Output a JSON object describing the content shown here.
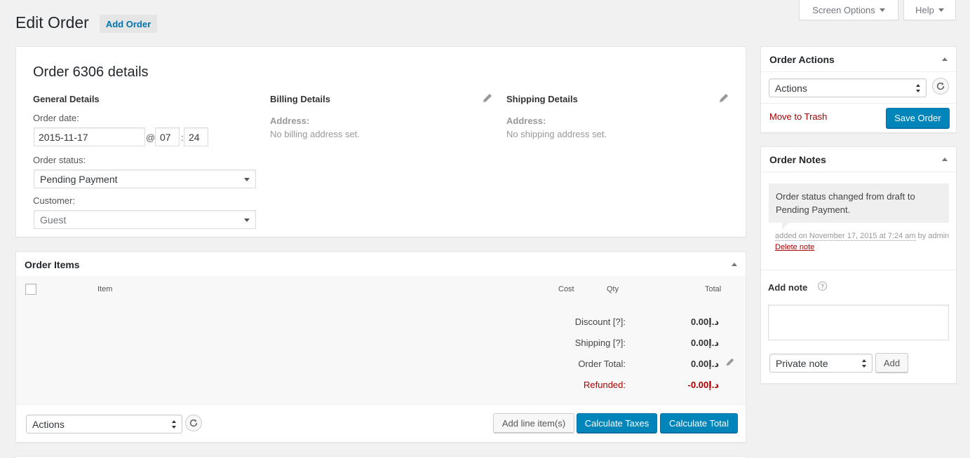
{
  "header": {
    "title": "Edit Order",
    "add_button": "Add Order",
    "screen_options": "Screen Options",
    "help": "Help"
  },
  "order_details": {
    "title": "Order 6306 details",
    "general": {
      "heading": "General Details",
      "date_label": "Order date:",
      "date_value": "2015-11-17",
      "at_symbol": "@",
      "hour": "07",
      "colon": ":",
      "minute": "24",
      "status_label": "Order status:",
      "status_value": "Pending Payment",
      "customer_label": "Customer:",
      "customer_value": "Guest"
    },
    "billing": {
      "heading": "Billing Details",
      "address_label": "Address:",
      "address_value": "No billing address set."
    },
    "shipping": {
      "heading": "Shipping Details",
      "address_label": "Address:",
      "address_value": "No shipping address set."
    }
  },
  "order_items": {
    "title": "Order Items",
    "columns": {
      "item": "Item",
      "cost": "Cost",
      "qty": "Qty",
      "total": "Total"
    },
    "totals": [
      {
        "label": "Discount [?]:",
        "value": "0.00د.إ"
      },
      {
        "label": "Shipping [?]:",
        "value": "0.00د.إ"
      },
      {
        "label": "Order Total:",
        "value": "0.00د.إ"
      },
      {
        "label": "Refunded:",
        "value": "-0.00د.إ"
      }
    ],
    "actions_select": "Actions",
    "add_line_items": "Add line item(s)",
    "calculate_taxes": "Calculate Taxes",
    "calculate_total": "Calculate Total"
  },
  "order_actions": {
    "title": "Order Actions",
    "select_value": "Actions",
    "move_to_trash": "Move to Trash",
    "save_order": "Save Order"
  },
  "order_notes": {
    "title": "Order Notes",
    "note_text": "Order status changed from draft to Pending Payment.",
    "meta_added": "added on November 17, 2015 at 7:24 am",
    "meta_by": "by",
    "meta_author": "admin",
    "delete_note": "Delete note",
    "add_note_label": "Add note",
    "note_type": "Private note",
    "add_button": "Add"
  },
  "colors": {
    "primary": "#0085ba",
    "danger": "#a00",
    "background": "#f1f1f1"
  }
}
